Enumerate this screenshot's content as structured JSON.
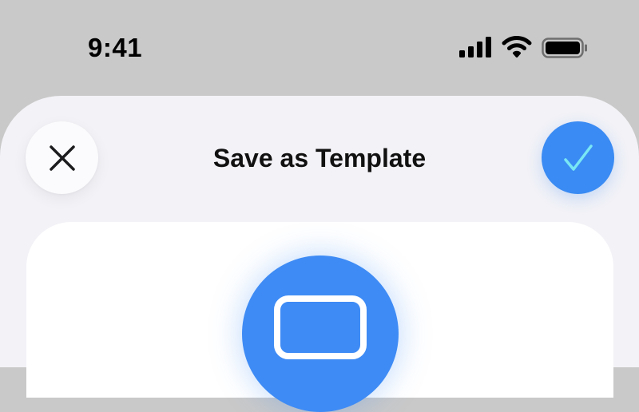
{
  "status_bar": {
    "time": "9:41",
    "icons": [
      "cellular-signal-icon",
      "wifi-icon",
      "battery-icon"
    ]
  },
  "sheet": {
    "title": "Save as Template",
    "close_icon": "close-icon",
    "confirm_icon": "checkmark-icon",
    "badge_icon": "template-icon"
  },
  "colors": {
    "background": "#c9c9c9",
    "sheet": "#f2f2f7",
    "card": "#ffffff",
    "accent": "#3a8bf3",
    "confirm_check": "#7ae7f5",
    "text": "#111111"
  }
}
